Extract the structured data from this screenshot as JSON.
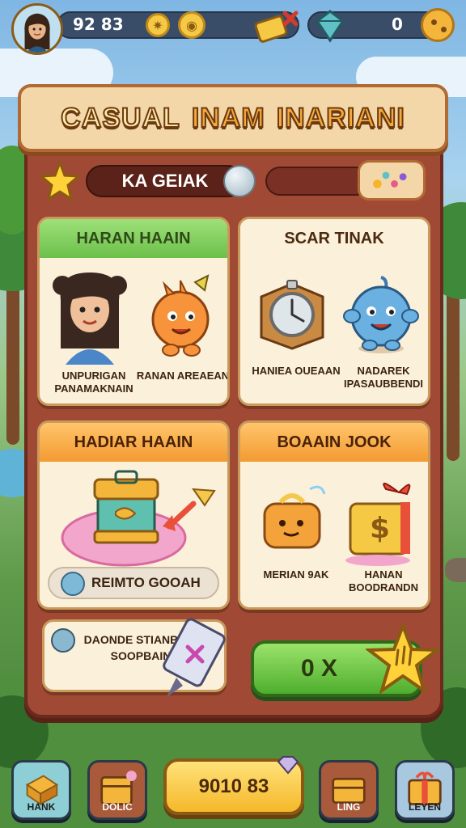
{
  "hud": {
    "score": "92 83",
    "currency": "0"
  },
  "title": {
    "word1": "CASUAL",
    "word2": "INAM",
    "word3": "INARIANI"
  },
  "level": {
    "label": "KA GEIAK"
  },
  "cards": [
    {
      "header": "HARAN HAAIN",
      "left_caption": "UNPURIGAN PANAMAKNAIN",
      "right_caption": "RANAN AREAEAN"
    },
    {
      "header": "SCAR TINAK",
      "left_caption": "HANIEA OUEAAN",
      "right_caption": "NADAREK IPASAUBBENDI"
    },
    {
      "header": "HADIAR HAAIN",
      "pill_label": "REIMTO GOOAH"
    },
    {
      "header": "BOAAIN JOOK",
      "left_caption": "MERIAN 9AK",
      "right_caption": "HANAN BOODRANDN"
    }
  ],
  "info_card": {
    "text": "DAONDE STIANBAIN SOOPBAIN"
  },
  "go_button": {
    "label": "0 X"
  },
  "bottom_nav": {
    "items": [
      {
        "label": "HANK",
        "icon": "box-icon"
      },
      {
        "label": "DOLIC",
        "icon": "crate-icon"
      },
      {
        "label": "9010 83",
        "icon": "gem-icon"
      },
      {
        "label": "LING",
        "icon": "chest-icon"
      },
      {
        "label": "LEYEN",
        "icon": "gift-icon"
      }
    ]
  },
  "colors": {
    "panel": "#a04a36",
    "card": "#fbf0da",
    "accent_green": "#6cc04a",
    "accent_orange": "#f39a32",
    "accent_gold": "#f5b82a"
  }
}
